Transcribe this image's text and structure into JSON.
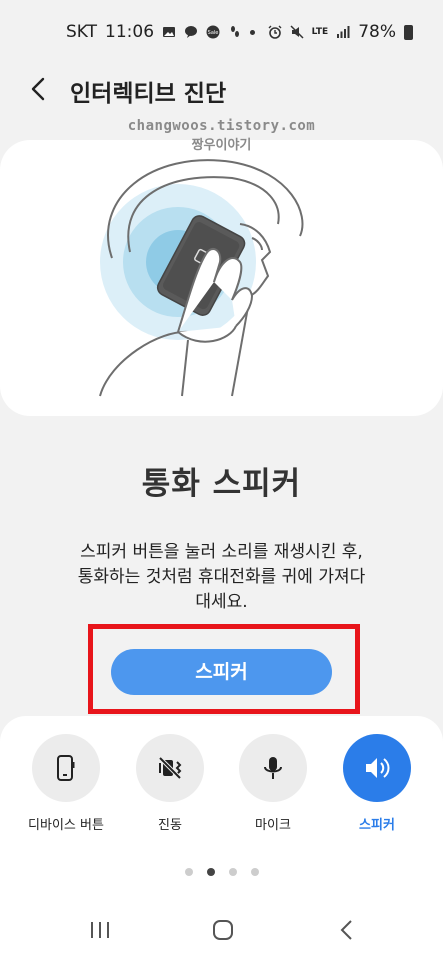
{
  "status_bar": {
    "carrier": "SKT",
    "time": "11:06",
    "network": "LTE",
    "battery": "78%",
    "icons": [
      "image-icon",
      "talk-icon",
      "sale-icon",
      "walk-icon",
      "alarm-icon",
      "mute-icon",
      "signal-icon",
      "battery-icon"
    ]
  },
  "header": {
    "title": "인터렉티브 진단",
    "back_icon": "back-arrow-icon"
  },
  "watermark": {
    "line1": "changwoos.tistory.com",
    "line2": "짱우이야기"
  },
  "illustration": {
    "name": "person-holding-phone-to-ear"
  },
  "content": {
    "title": "통화 스피커",
    "description_line1": "스피커 버튼을 눌러 소리를 재생시킨 후,",
    "description_line2": "통화하는 것처럼 휴대전화를 귀에 가져다",
    "description_line3": "대세요.",
    "button_label": "스피커"
  },
  "highlight_color": "#e8151b",
  "accent_color": "#2b7de9",
  "tests": [
    {
      "label": "디바이스 버튼",
      "icon": "device-button-icon",
      "active": false
    },
    {
      "label": "진동",
      "icon": "vibration-off-icon",
      "active": false
    },
    {
      "label": "마이크",
      "icon": "microphone-icon",
      "active": false
    },
    {
      "label": "스피커",
      "icon": "speaker-icon",
      "active": true
    }
  ],
  "pagination": {
    "count": 4,
    "current": 2
  },
  "nav_bar": {
    "icons": [
      "recent-apps-icon",
      "home-icon",
      "back-icon"
    ]
  }
}
